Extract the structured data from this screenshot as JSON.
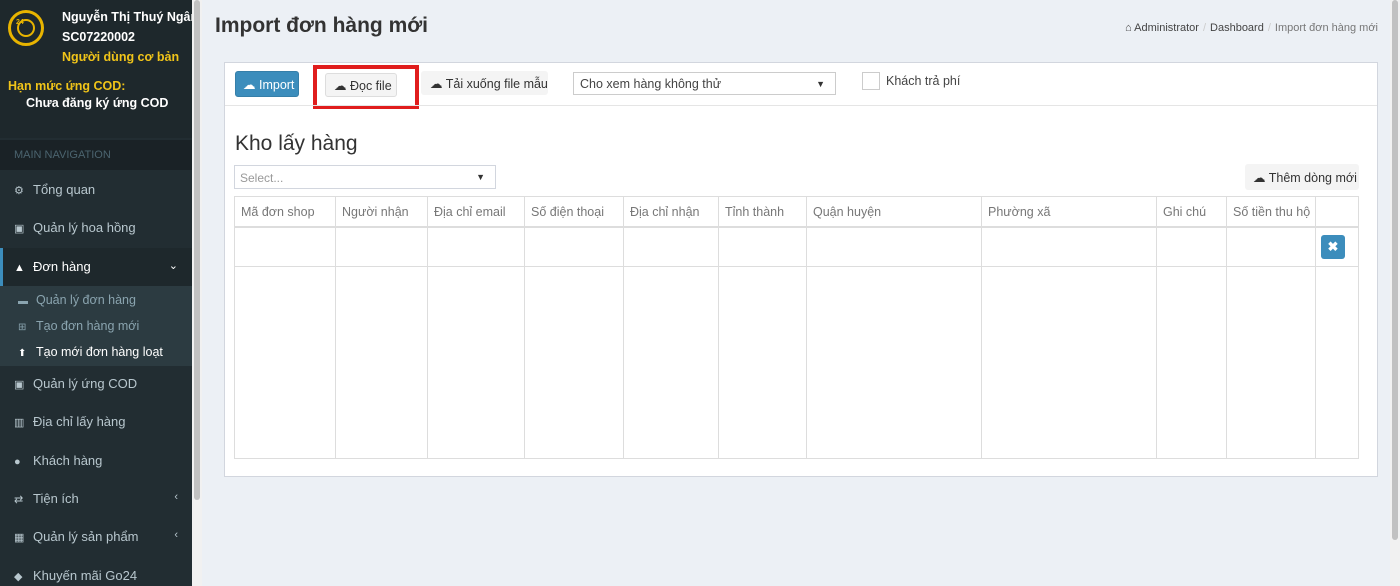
{
  "user": {
    "name": "Nguyễn Thị Thuý Ngân",
    "code": "SC07220002",
    "role": "Người dùng cơ bản",
    "cod_label": "Hạn mức ứng COD:",
    "cod_value": "Chưa đăng ký ứng COD",
    "logo_text": "24"
  },
  "sidebar": {
    "header": "MAIN NAVIGATION",
    "items": [
      {
        "label": "Tổng quan",
        "icon": "dashboard-icon",
        "glyph": "⚙"
      },
      {
        "label": "Quản lý hoa hồng",
        "icon": "money-icon",
        "glyph": "▣"
      },
      {
        "label": "Đơn hàng",
        "icon": "shopping-bag-icon",
        "glyph": "▲",
        "arrow": "⌄"
      },
      {
        "label": "Quản lý ứng COD",
        "icon": "money-icon",
        "glyph": "▣"
      },
      {
        "label": "Địa chỉ lấy hàng",
        "icon": "bank-icon",
        "glyph": "▥"
      },
      {
        "label": "Khách hàng",
        "icon": "user-icon",
        "glyph": "●"
      },
      {
        "label": "Tiện ích",
        "icon": "exchange-icon",
        "glyph": "⇄",
        "arrow": "‹"
      },
      {
        "label": "Quản lý sản phẩm",
        "icon": "barcode-icon",
        "glyph": "▦",
        "arrow": "‹"
      },
      {
        "label": "Khuyến mãi Go24",
        "icon": "gift-icon",
        "glyph": "◆"
      }
    ],
    "submenu": [
      {
        "label": "Quản lý đơn hàng",
        "icon": "truck-icon",
        "glyph": "▬"
      },
      {
        "label": "Tạo đơn hàng mới",
        "icon": "cart-icon",
        "glyph": "⊞"
      },
      {
        "label": "Tạo mới đơn hàng loạt",
        "icon": "upload-icon",
        "glyph": "⬆"
      }
    ]
  },
  "header": {
    "title": "Import đơn hàng mới",
    "breadcrumb": [
      "Administrator",
      "Dashboard",
      "Import đơn hàng mới"
    ]
  },
  "toolbar": {
    "import_label": "Import",
    "read_file_label": "Đọc file",
    "download_template_label": "Tải xuống file mẫu",
    "view_option_selected": "Cho xem hàng không thử",
    "customer_pays_label": "Khách trả phí"
  },
  "warehouse": {
    "title": "Kho lấy hàng",
    "select_placeholder": "Select...",
    "add_row_label": "Thêm dòng mới"
  },
  "table": {
    "columns": [
      "Mã đơn shop",
      "Người nhận",
      "Địa chỉ email",
      "Số điện thoại",
      "Địa chỉ nhận",
      "Tỉnh thành",
      "Quận huyện",
      "Phường xã",
      "Ghi chú",
      "Số tiền thu hộ",
      ""
    ]
  },
  "colors": {
    "sidebar_bg": "#222d32",
    "accent": "#3c8dbc",
    "highlight": "#e01d1d",
    "warning_text": "#f0c419"
  }
}
